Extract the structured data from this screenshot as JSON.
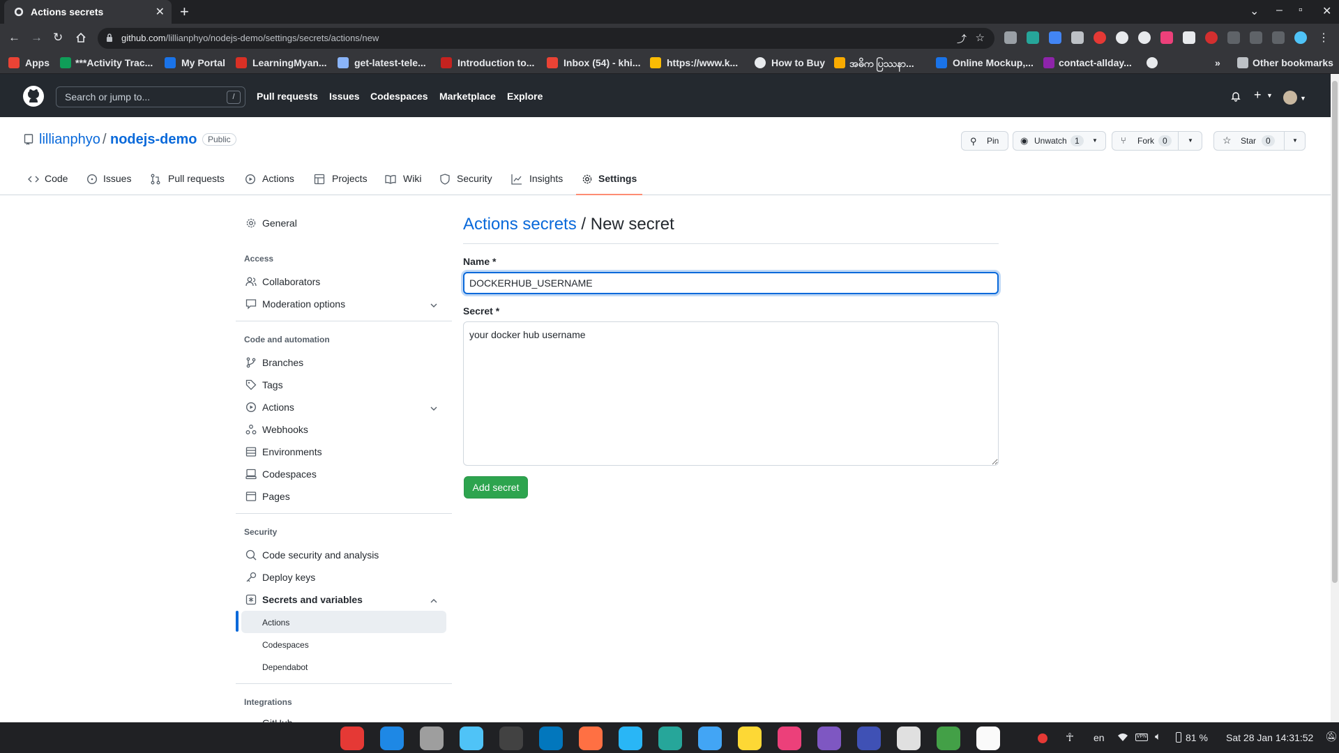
{
  "browser": {
    "tab_title": "Actions secrets",
    "new_tab": "+",
    "url_host": "github.com",
    "url_path": "/lillianphyo/nodejs-demo/settings/secrets/actions/new",
    "bookmarks": [
      {
        "label": "Apps",
        "color": "#ea4335"
      },
      {
        "label": "***Activity Trac...",
        "color": "#0f9d58"
      },
      {
        "label": "My Portal",
        "color": "#1a73e8"
      },
      {
        "label": "LearningMyan...",
        "color": "#d93025"
      },
      {
        "label": "get-latest-tele...",
        "color": "#8ab4f8"
      },
      {
        "label": "Introduction to...",
        "color": "#c5221f"
      },
      {
        "label": "Inbox (54) - khi...",
        "color": "#ea4335"
      },
      {
        "label": "https://www.k...",
        "color": "#fbbc04"
      },
      {
        "label": "How to Buy",
        "color": "#e8eaed"
      },
      {
        "label": "အဓိက ပြဿနာ...",
        "color": "#f9ab00"
      },
      {
        "label": "Online Mockup,...",
        "color": "#1a73e8"
      },
      {
        "label": "contact-allday...",
        "color": "#8e24aa"
      }
    ],
    "more_bookmarks": "»",
    "other_bookmarks": "Other bookmarks"
  },
  "github": {
    "search_placeholder": "Search or jump to...",
    "search_shortcut": "/",
    "nav": [
      "Pull requests",
      "Issues",
      "Codespaces",
      "Marketplace",
      "Explore"
    ]
  },
  "repo": {
    "owner": "lillianphyo",
    "separator": "/",
    "name": "nodejs-demo",
    "visibility": "Public",
    "pin_label": "Pin",
    "unwatch_label": "Unwatch",
    "unwatch_count": "1",
    "fork_label": "Fork",
    "fork_count": "0",
    "star_label": "Star",
    "star_count": "0",
    "tabs": [
      "Code",
      "Issues",
      "Pull requests",
      "Actions",
      "Projects",
      "Wiki",
      "Security",
      "Insights",
      "Settings"
    ]
  },
  "sidebar": {
    "general": "General",
    "access_heading": "Access",
    "collaborators": "Collaborators",
    "moderation": "Moderation options",
    "code_heading": "Code and automation",
    "branches": "Branches",
    "tags": "Tags",
    "actions": "Actions",
    "webhooks": "Webhooks",
    "environments": "Environments",
    "codespaces": "Codespaces",
    "pages": "Pages",
    "security_heading": "Security",
    "code_security": "Code security and analysis",
    "deploy_keys": "Deploy keys",
    "secrets_vars": "Secrets and variables",
    "sub_actions": "Actions",
    "sub_codespaces": "Codespaces",
    "sub_dependabot": "Dependabot",
    "integrations_heading": "Integrations",
    "integrations_first": "GitHub"
  },
  "form": {
    "title_link": "Actions secrets",
    "title_rest": " / New secret",
    "name_label": "Name *",
    "name_value": "DOCKERHUB_USERNAME",
    "secret_label": "Secret *",
    "secret_value": "your docker hub username",
    "submit_label": "Add secret"
  },
  "taskbar": {
    "lang": "en",
    "battery": "81 %",
    "clock": "Sat 28 Jan  14:31:52",
    "apps": [
      {
        "name": "screenshot-app",
        "color": "#e53935"
      },
      {
        "name": "vscode",
        "color": "#1e88e5"
      },
      {
        "name": "files",
        "color": "#9e9e9e"
      },
      {
        "name": "reader",
        "color": "#4fc3f7"
      },
      {
        "name": "terminal",
        "color": "#424242"
      },
      {
        "name": "virtualbox",
        "color": "#0277bd"
      },
      {
        "name": "firefox",
        "color": "#ff7043"
      },
      {
        "name": "telegram",
        "color": "#29b6f6"
      },
      {
        "name": "teams-like",
        "color": "#26a69a"
      },
      {
        "name": "packager",
        "color": "#42a5f5"
      },
      {
        "name": "miro",
        "color": "#fdd835"
      },
      {
        "name": "clickup",
        "color": "#ec407a"
      },
      {
        "name": "obsidian",
        "color": "#7e57c2"
      },
      {
        "name": "pycharm",
        "color": "#3f51b5"
      },
      {
        "name": "slack",
        "color": "#e0e0e0"
      },
      {
        "name": "chrome",
        "color": "#43a047"
      },
      {
        "name": "text-editor",
        "color": "#fafafa"
      }
    ]
  }
}
